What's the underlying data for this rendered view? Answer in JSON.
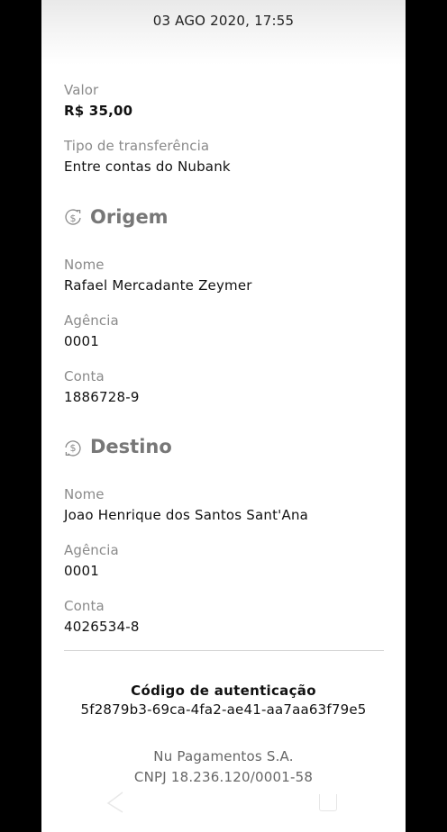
{
  "header": {
    "datetime": "03 AGO 2020, 17:55"
  },
  "transfer": {
    "value_label": "Valor",
    "value": "R$ 35,00",
    "type_label": "Tipo de transferência",
    "type_value": "Entre contas do Nubank"
  },
  "origin": {
    "icon": "money-out-icon",
    "title": "Origem",
    "name_label": "Nome",
    "name": "Rafael Mercadante Zeymer",
    "agency_label": "Agência",
    "agency": "0001",
    "account_label": "Conta",
    "account": "1886728-9"
  },
  "destination": {
    "icon": "money-in-icon",
    "title": "Destino",
    "name_label": "Nome",
    "name": "Joao Henrique dos Santos Sant'Ana",
    "agency_label": "Agência",
    "agency": "0001",
    "account_label": "Conta",
    "account": "4026534-8"
  },
  "authentication": {
    "title": "Código de autenticação",
    "code": "5f2879b3-69ca-4fa2-ae41-aa7aa63f79e5"
  },
  "footer": {
    "company": "Nu Pagamentos S.A.",
    "cnpj": "CNPJ 18.236.120/0001-58"
  },
  "colors": {
    "label": "#8a8a8a",
    "value": "#111111",
    "section_title": "#777777"
  }
}
